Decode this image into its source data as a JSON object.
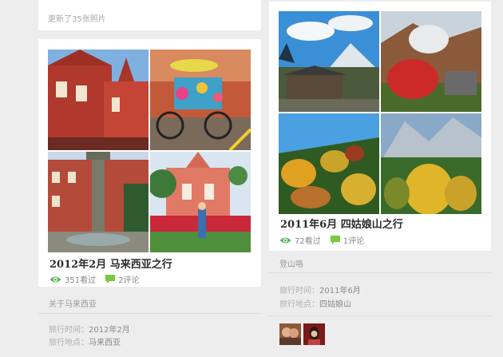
{
  "top_left_card": {
    "text": "更新了35张照片"
  },
  "left_album": {
    "title": "2012年2月 马来西亚之行",
    "views": "351看过",
    "comments": "2评论",
    "section_title": "关于马来西亚",
    "time_label": "旅行时间：",
    "time_value": "2012年2月",
    "place_label": "旅行地点：",
    "place_value": "马来西亚"
  },
  "right_album": {
    "title": "2011年6月 四姑娘山之行",
    "views": "72看过",
    "comments": "1评论",
    "section_title": "登山咯",
    "time_label": "旅行时间：",
    "time_value": "2011年6月",
    "place_label": "旅行地点：",
    "place_value": "四姑娘山"
  },
  "colors": {
    "eye_icon": "#5cb85c",
    "comment_icon": "#7ac943",
    "title": "#2e2e2e",
    "muted": "#a8a8a8"
  }
}
